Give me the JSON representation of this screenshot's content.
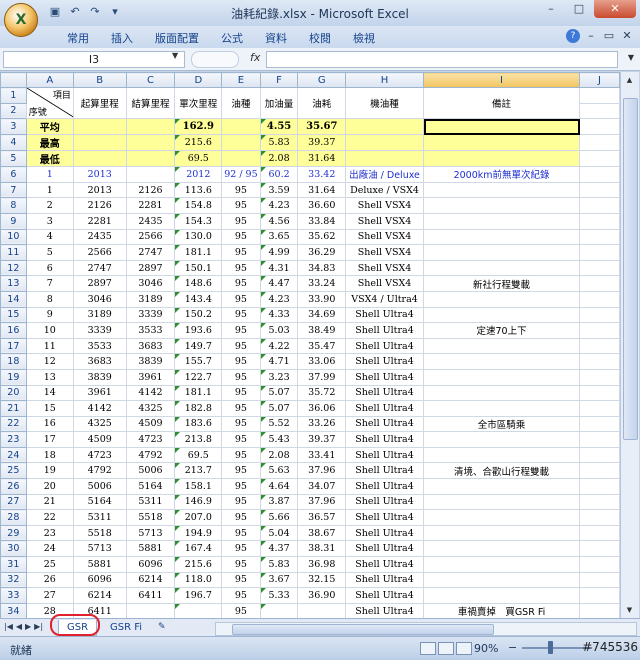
{
  "window": {
    "title": "油耗紀錄.xlsx - Microsoft Excel",
    "office_button_glyph": "X"
  },
  "quick_access": {
    "save_icon": "save-icon",
    "undo_icon": "undo-icon",
    "redo_icon": "redo-icon",
    "customize_icon": "customize-icon"
  },
  "ribbon": {
    "tabs": [
      "常用",
      "插入",
      "版面配置",
      "公式",
      "資料",
      "校閱",
      "檢視"
    ],
    "help_glyph": "?"
  },
  "formula_bar": {
    "name_box": "I3",
    "fx_label": "fx",
    "content": ""
  },
  "columns": [
    "A",
    "B",
    "C",
    "D",
    "E",
    "F",
    "G",
    "H",
    "I",
    "J"
  ],
  "header_rows": {
    "a_top": "項目",
    "a_bottom": "序號",
    "B": "起算里程",
    "C": "結算里程",
    "D": "單次里程",
    "E": "油種",
    "F": "加油量",
    "G": "油耗",
    "H": "機油種",
    "I": "備註"
  },
  "summary": [
    {
      "row": "3",
      "label": "平均",
      "D": "162.9",
      "F": "4.55",
      "G": "35.67"
    },
    {
      "row": "4",
      "label": "最高",
      "D": "215.6",
      "F": "5.83",
      "G": "39.37"
    },
    {
      "row": "5",
      "label": "最低",
      "D": "69.5",
      "F": "2.08",
      "G": "31.64"
    }
  ],
  "row6": {
    "row": "6",
    "A": "1",
    "B": "2013",
    "D": "2012",
    "E": "92 / 95",
    "F": "60.2",
    "G": "33.42",
    "H": "出廠油 / Deluxe",
    "I": "2000km前無單次紀錄"
  },
  "rows": [
    {
      "row": "7",
      "A": "1",
      "B": "2013",
      "C": "2126",
      "D": "113.6",
      "E": "95",
      "F": "3.59",
      "G": "31.64",
      "H": "Deluxe / VSX4",
      "I": ""
    },
    {
      "row": "8",
      "A": "2",
      "B": "2126",
      "C": "2281",
      "D": "154.8",
      "E": "95",
      "F": "4.23",
      "G": "36.60",
      "H": "Shell VSX4",
      "I": ""
    },
    {
      "row": "9",
      "A": "3",
      "B": "2281",
      "C": "2435",
      "D": "154.3",
      "E": "95",
      "F": "4.56",
      "G": "33.84",
      "H": "Shell VSX4",
      "I": ""
    },
    {
      "row": "10",
      "A": "4",
      "B": "2435",
      "C": "2566",
      "D": "130.0",
      "E": "95",
      "F": "3.65",
      "G": "35.62",
      "H": "Shell VSX4",
      "I": ""
    },
    {
      "row": "11",
      "A": "5",
      "B": "2566",
      "C": "2747",
      "D": "181.1",
      "E": "95",
      "F": "4.99",
      "G": "36.29",
      "H": "Shell VSX4",
      "I": ""
    },
    {
      "row": "12",
      "A": "6",
      "B": "2747",
      "C": "2897",
      "D": "150.1",
      "E": "95",
      "F": "4.31",
      "G": "34.83",
      "H": "Shell VSX4",
      "I": ""
    },
    {
      "row": "13",
      "A": "7",
      "B": "2897",
      "C": "3046",
      "D": "148.6",
      "E": "95",
      "F": "4.47",
      "G": "33.24",
      "H": "Shell VSX4",
      "I": "新社行程雙載"
    },
    {
      "row": "14",
      "A": "8",
      "B": "3046",
      "C": "3189",
      "D": "143.4",
      "E": "95",
      "F": "4.23",
      "G": "33.90",
      "H": "VSX4 / Ultra4",
      "I": ""
    },
    {
      "row": "15",
      "A": "9",
      "B": "3189",
      "C": "3339",
      "D": "150.2",
      "E": "95",
      "F": "4.33",
      "G": "34.69",
      "H": "Shell Ultra4",
      "I": ""
    },
    {
      "row": "16",
      "A": "10",
      "B": "3339",
      "C": "3533",
      "D": "193.6",
      "E": "95",
      "F": "5.03",
      "G": "38.49",
      "H": "Shell Ultra4",
      "I": "定速70上下"
    },
    {
      "row": "17",
      "A": "11",
      "B": "3533",
      "C": "3683",
      "D": "149.7",
      "E": "95",
      "F": "4.22",
      "G": "35.47",
      "H": "Shell Ultra4",
      "I": ""
    },
    {
      "row": "18",
      "A": "12",
      "B": "3683",
      "C": "3839",
      "D": "155.7",
      "E": "95",
      "F": "4.71",
      "G": "33.06",
      "H": "Shell Ultra4",
      "I": ""
    },
    {
      "row": "19",
      "A": "13",
      "B": "3839",
      "C": "3961",
      "D": "122.7",
      "E": "95",
      "F": "3.23",
      "G": "37.99",
      "H": "Shell Ultra4",
      "I": ""
    },
    {
      "row": "20",
      "A": "14",
      "B": "3961",
      "C": "4142",
      "D": "181.1",
      "E": "95",
      "F": "5.07",
      "G": "35.72",
      "H": "Shell Ultra4",
      "I": ""
    },
    {
      "row": "21",
      "A": "15",
      "B": "4142",
      "C": "4325",
      "D": "182.8",
      "E": "95",
      "F": "5.07",
      "G": "36.06",
      "H": "Shell Ultra4",
      "I": ""
    },
    {
      "row": "22",
      "A": "16",
      "B": "4325",
      "C": "4509",
      "D": "183.6",
      "E": "95",
      "F": "5.52",
      "G": "33.26",
      "H": "Shell Ultra4",
      "I": "全市區騎乘"
    },
    {
      "row": "23",
      "A": "17",
      "B": "4509",
      "C": "4723",
      "D": "213.8",
      "E": "95",
      "F": "5.43",
      "G": "39.37",
      "H": "Shell Ultra4",
      "I": ""
    },
    {
      "row": "24",
      "A": "18",
      "B": "4723",
      "C": "4792",
      "D": "69.5",
      "E": "95",
      "F": "2.08",
      "G": "33.41",
      "H": "Shell Ultra4",
      "I": ""
    },
    {
      "row": "25",
      "A": "19",
      "B": "4792",
      "C": "5006",
      "D": "213.7",
      "E": "95",
      "F": "5.63",
      "G": "37.96",
      "H": "Shell Ultra4",
      "I": "清境、合歡山行程雙載"
    },
    {
      "row": "26",
      "A": "20",
      "B": "5006",
      "C": "5164",
      "D": "158.1",
      "E": "95",
      "F": "4.64",
      "G": "34.07",
      "H": "Shell Ultra4",
      "I": ""
    },
    {
      "row": "27",
      "A": "21",
      "B": "5164",
      "C": "5311",
      "D": "146.9",
      "E": "95",
      "F": "3.87",
      "G": "37.96",
      "H": "Shell Ultra4",
      "I": ""
    },
    {
      "row": "28",
      "A": "22",
      "B": "5311",
      "C": "5518",
      "D": "207.0",
      "E": "95",
      "F": "5.66",
      "G": "36.57",
      "H": "Shell Ultra4",
      "I": ""
    },
    {
      "row": "29",
      "A": "23",
      "B": "5518",
      "C": "5713",
      "D": "194.9",
      "E": "95",
      "F": "5.04",
      "G": "38.67",
      "H": "Shell Ultra4",
      "I": ""
    },
    {
      "row": "30",
      "A": "24",
      "B": "5713",
      "C": "5881",
      "D": "167.4",
      "E": "95",
      "F": "4.37",
      "G": "38.31",
      "H": "Shell Ultra4",
      "I": ""
    },
    {
      "row": "31",
      "A": "25",
      "B": "5881",
      "C": "6096",
      "D": "215.6",
      "E": "95",
      "F": "5.83",
      "G": "36.98",
      "H": "Shell Ultra4",
      "I": ""
    },
    {
      "row": "32",
      "A": "26",
      "B": "6096",
      "C": "6214",
      "D": "118.0",
      "E": "95",
      "F": "3.67",
      "G": "32.15",
      "H": "Shell Ultra4",
      "I": ""
    },
    {
      "row": "33",
      "A": "27",
      "B": "6214",
      "C": "6411",
      "D": "196.7",
      "E": "95",
      "F": "5.33",
      "G": "36.90",
      "H": "Shell Ultra4",
      "I": ""
    },
    {
      "row": "34",
      "A": "28",
      "B": "6411",
      "C": "",
      "D": "",
      "E": "95",
      "F": "",
      "G": "",
      "H": "Shell Ultra4",
      "I": "車禍賣掉　買GSR Fi"
    }
  ],
  "row35": {
    "row": "35"
  },
  "sheet_tabs": [
    "GSR",
    "GSR Fi"
  ],
  "status": {
    "ready": "就緒",
    "zoom": "90%",
    "zoom_minus": "−",
    "watermark": "#745536"
  },
  "colors": {
    "highlight_yellow": "#ffff99",
    "blue_text": "#1f2fd0",
    "annotation_red": "#e0202a"
  }
}
